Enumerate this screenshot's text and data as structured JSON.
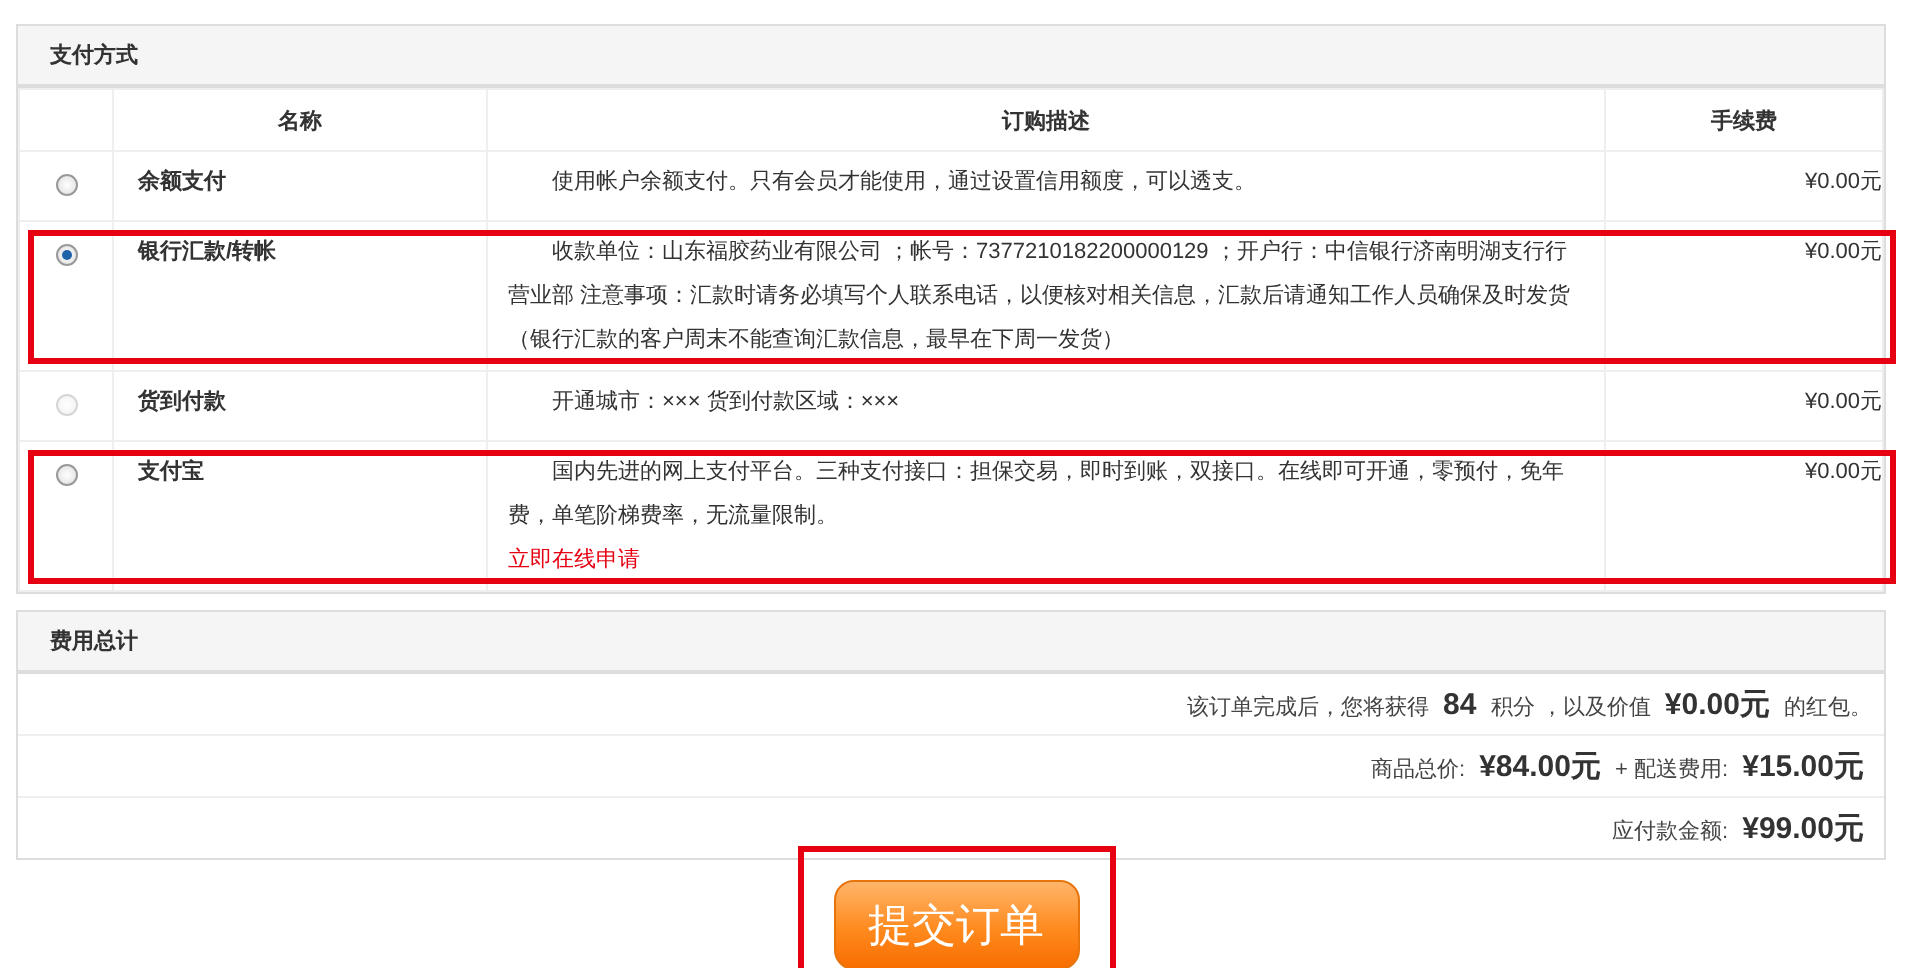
{
  "payment": {
    "title": "支付方式",
    "columns": [
      "名称",
      "订购描述",
      "手续费"
    ],
    "methods": [
      {
        "name": "余额支付",
        "description": "使用帐户余额支付。只有会员才能使用，通过设置信用额度，可以透支。",
        "fee": "¥0.00元",
        "selected": false,
        "disabled": false,
        "highlighted": false
      },
      {
        "name": "银行汇款/转帐",
        "description": "收款单位：山东福胶药业有限公司 ；帐号：7377210182200000129 ；开户行：中信银行济南明湖支行行营业部 注意事项：汇款时请务必填写个人联系电话，以便核对相关信息，汇款后请通知工作人员确保及时发货（银行汇款的客户周末不能查询汇款信息，最早在下周一发货）",
        "fee": "¥0.00元",
        "selected": true,
        "disabled": false,
        "highlighted": true
      },
      {
        "name": "货到付款",
        "description": "开通城市：×××  货到付款区域：×××",
        "fee": "¥0.00元",
        "selected": false,
        "disabled": true,
        "highlighted": false
      },
      {
        "name": "支付宝",
        "description": "国内先进的网上支付平台。三种支付接口：担保交易，即时到账，双接口。在线即可开通，零预付，免年费，单笔阶梯费率，无流量限制。",
        "link": "立即在线申请",
        "fee": "¥0.00元",
        "selected": false,
        "disabled": false,
        "highlighted": true
      }
    ]
  },
  "totals": {
    "title": "费用总计",
    "lines": [
      "该订单完成后，您将获得 **84** 积分 ，以及价值 **¥0.00元** 的红包。",
      "商品总价: **¥84.00元** + 配送费用: **¥15.00元**",
      "应付款金额: **¥99.00元**"
    ]
  },
  "submit": {
    "label": "提交订单",
    "highlighted": true
  }
}
